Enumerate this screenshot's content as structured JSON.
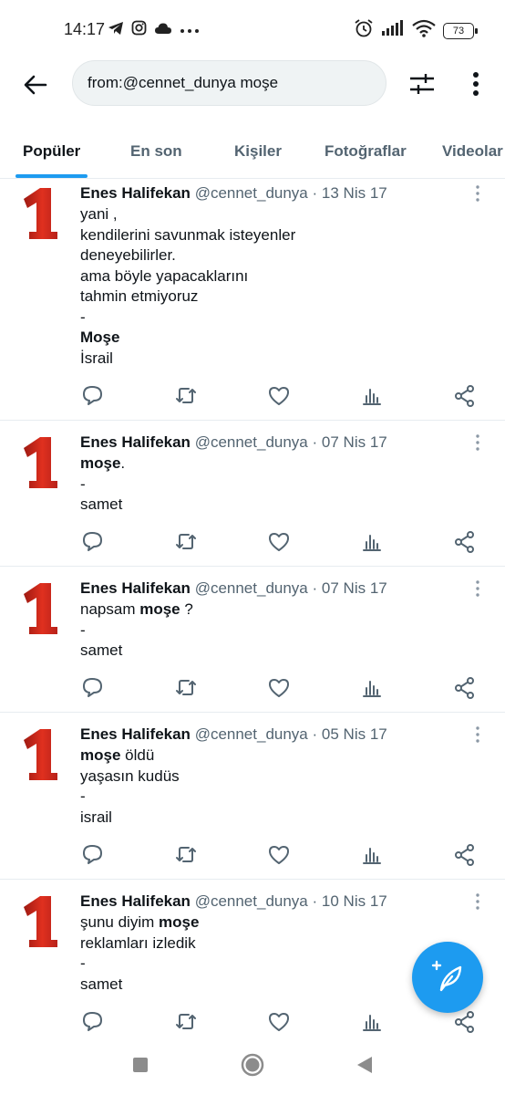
{
  "status_bar": {
    "time": "14:17",
    "battery": "73"
  },
  "search": {
    "query": "from:@cennet_dunya moşe"
  },
  "tabs": [
    {
      "label": "Popüler",
      "active": true
    },
    {
      "label": "En son",
      "active": false
    },
    {
      "label": "Kişiler",
      "active": false
    },
    {
      "label": "Fotoğraflar",
      "active": false
    },
    {
      "label": "Videolar",
      "active": false
    }
  ],
  "tweets": [
    {
      "author": "Enes Halifekan",
      "handle": "@cennet_dunya",
      "separator": "·",
      "date": "13 Nis 17",
      "lines": [
        [
          {
            "t": "yani ,",
            "b": false
          }
        ],
        [
          {
            "t": "kendilerini savunmak isteyenler",
            "b": false
          }
        ],
        [
          {
            "t": "deneyebilirler.",
            "b": false
          }
        ],
        [
          {
            "t": "ama böyle yapacaklarını",
            "b": false
          }
        ],
        [
          {
            "t": "tahmin etmiyoruz",
            "b": false
          }
        ],
        [
          {
            "t": "-",
            "b": false
          }
        ],
        [
          {
            "t": "Moşe",
            "b": true
          }
        ],
        [
          {
            "t": "İsrail",
            "b": false
          }
        ]
      ]
    },
    {
      "author": "Enes Halifekan",
      "handle": "@cennet_dunya",
      "separator": "·",
      "date": "07 Nis 17",
      "lines": [
        [
          {
            "t": "moşe",
            "b": true
          },
          {
            "t": ".",
            "b": false
          }
        ],
        [
          {
            "t": "-",
            "b": false
          }
        ],
        [
          {
            "t": "samet",
            "b": false
          }
        ]
      ]
    },
    {
      "author": "Enes Halifekan",
      "handle": "@cennet_dunya",
      "separator": "·",
      "date": "07 Nis 17",
      "lines": [
        [
          {
            "t": "napsam ",
            "b": false
          },
          {
            "t": "moşe",
            "b": true
          },
          {
            "t": " ?",
            "b": false
          }
        ],
        [
          {
            "t": "-",
            "b": false
          }
        ],
        [
          {
            "t": "samet",
            "b": false
          }
        ]
      ]
    },
    {
      "author": "Enes Halifekan",
      "handle": "@cennet_dunya",
      "separator": "·",
      "date": "05 Nis 17",
      "lines": [
        [
          {
            "t": "moşe",
            "b": true
          },
          {
            "t": " öldü",
            "b": false
          }
        ],
        [
          {
            "t": "yaşasın kudüs",
            "b": false
          }
        ],
        [
          {
            "t": "-",
            "b": false
          }
        ],
        [
          {
            "t": "israil",
            "b": false
          }
        ]
      ]
    },
    {
      "author": "Enes Halifekan",
      "handle": "@cennet_dunya",
      "separator": "·",
      "date": "10 Nis 17",
      "lines": [
        [
          {
            "t": "şunu diyim ",
            "b": false
          },
          {
            "t": "moşe",
            "b": true
          }
        ],
        [
          {
            "t": "reklamları izledik",
            "b": false
          }
        ],
        [
          {
            "t": "-",
            "b": false
          }
        ],
        [
          {
            "t": "samet",
            "b": false
          }
        ]
      ]
    }
  ],
  "colors": {
    "accent": "#1d9bf0",
    "text": "#0f1419",
    "muted": "#536471",
    "avatar_red": "#d42a1e"
  }
}
